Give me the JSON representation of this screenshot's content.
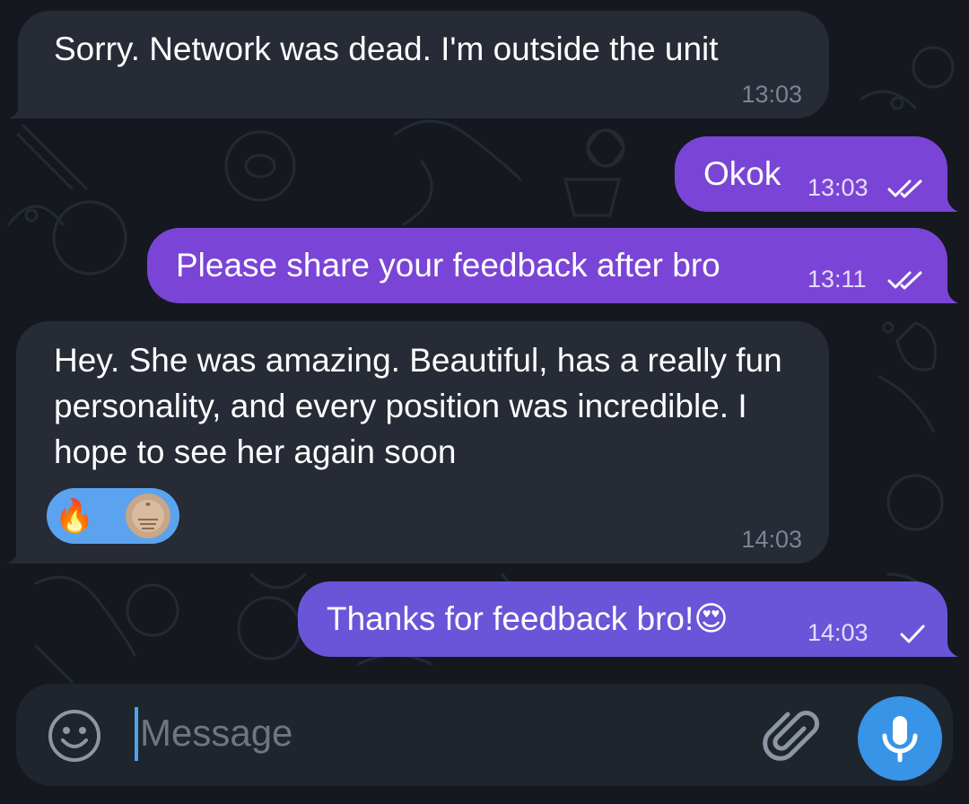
{
  "messages": [
    {
      "direction": "incoming",
      "text": "Sorry. Network was dead. I'm outside the unit",
      "time": "13:03"
    },
    {
      "direction": "outgoing",
      "text": "Okok",
      "time": "13:03",
      "status": "read"
    },
    {
      "direction": "outgoing",
      "text": "Please share your feedback after bro",
      "time": "13:11",
      "status": "read"
    },
    {
      "direction": "incoming",
      "text": "Hey. She was amazing. Beautiful, has a really fun personality, and every position was incredible. I hope to see her again soon",
      "time": "14:03",
      "reactions": [
        {
          "emoji": "🔥"
        },
        {
          "icon": "user-avatar-icon"
        }
      ]
    },
    {
      "direction": "outgoing",
      "text": "Thanks for feedback bro!😍",
      "time": "14:03",
      "status": "sent"
    }
  ],
  "composer": {
    "placeholder": "Message",
    "emoji_icon": "smiley-icon",
    "attach_icon": "paperclip-icon",
    "mic_icon": "microphone-icon"
  },
  "colors": {
    "background": "#15191f",
    "incoming_bubble": "#262b35",
    "outgoing_bubble": "#7a45d6",
    "accent": "#3794e6"
  }
}
